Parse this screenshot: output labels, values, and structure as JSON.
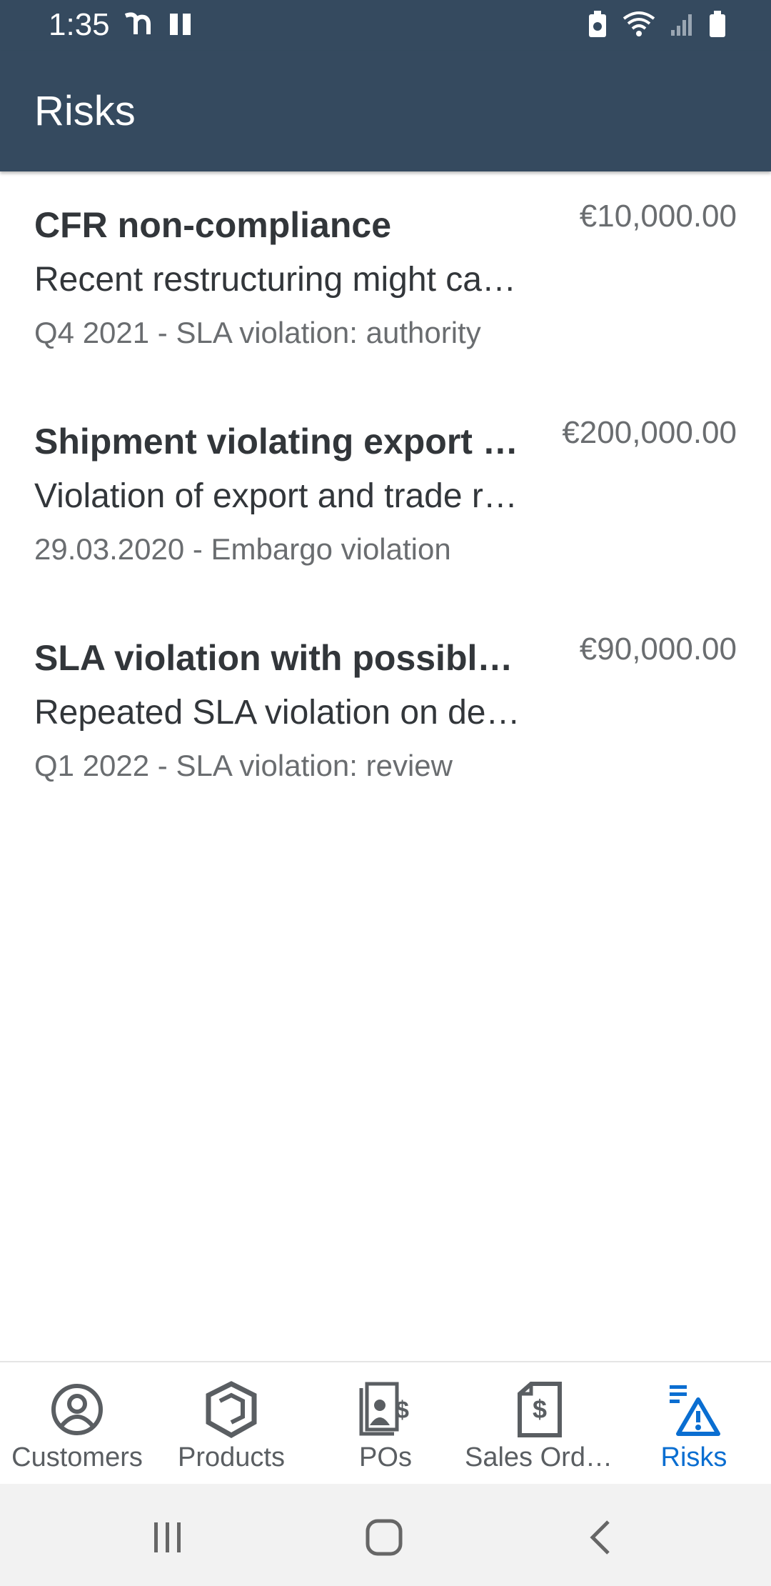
{
  "status": {
    "time": "1:35"
  },
  "appbar": {
    "title": "Risks"
  },
  "risks": [
    {
      "title": "CFR non-compliance",
      "description": "Recent restructuring might cause non-compliance",
      "subtitle": "Q4 2021 - SLA violation: authority",
      "amount": "€10,000.00"
    },
    {
      "title": "Shipment violating export restrictions",
      "description": "Violation of export and trade regulations",
      "subtitle": "29.03.2020 - Embargo violation",
      "amount": "€200,000.00"
    },
    {
      "title": "SLA violation with possible penalty",
      "description": "Repeated SLA violation on delivery",
      "subtitle": "Q1 2022 - SLA violation: review",
      "amount": "€90,000.00"
    }
  ],
  "tabs": [
    {
      "label": "Customers",
      "icon": "customer-icon",
      "active": false
    },
    {
      "label": "Products",
      "icon": "product-box-icon",
      "active": false
    },
    {
      "label": "POs",
      "icon": "purchase-order-icon",
      "active": false
    },
    {
      "label": "Sales Orders",
      "icon": "sales-order-icon",
      "active": false
    },
    {
      "label": "Risks",
      "icon": "warning-icon",
      "active": true
    }
  ],
  "colors": {
    "header": "#354a5f",
    "accent": "#0a6ed1",
    "text": "#32363a",
    "secondary_text": "#6a6d70"
  }
}
